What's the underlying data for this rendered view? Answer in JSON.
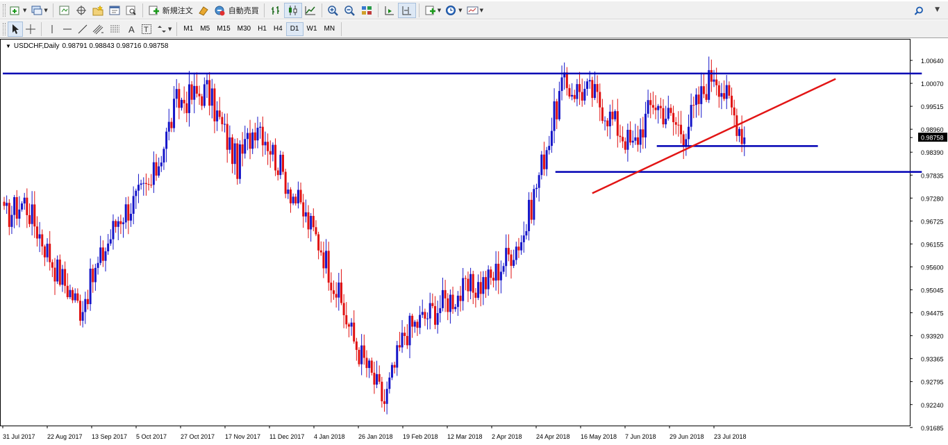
{
  "toolbar_top": {
    "new_order_label": "新規注文",
    "auto_trade_label": "自動売買"
  },
  "toolbar_bottom": {
    "timeframes": [
      "M1",
      "M5",
      "M15",
      "M30",
      "H1",
      "H4",
      "D1",
      "W1",
      "MN"
    ],
    "active_timeframe": "D1"
  },
  "chart": {
    "symbol_label": "USDCHF,Daily",
    "ohlc": "0.98791 0.98843 0.98716 0.98758",
    "current_price": "0.98758"
  },
  "colors": {
    "bull": "#1515c8",
    "bear": "#e01010",
    "hline": "#0000b4",
    "trendline": "#e21515",
    "price_tag_bg": "#000000"
  },
  "chart_data": {
    "type": "candlestick",
    "symbol": "USDCHF",
    "timeframe": "Daily",
    "y_ticks": [
      "1.00640",
      "1.00070",
      "0.99515",
      "0.98960",
      "0.98390",
      "0.97835",
      "0.97280",
      "0.96725",
      "0.96155",
      "0.95600",
      "0.95045",
      "0.94475",
      "0.93920",
      "0.93365",
      "0.92795",
      "0.92240",
      "0.91685"
    ],
    "x_ticks": [
      "31 Jul 2017",
      "22 Aug 2017",
      "13 Sep 2017",
      "5 Oct 2017",
      "27 Oct 2017",
      "17 Nov 2017",
      "11 Dec 2017",
      "4 Jan 2018",
      "26 Jan 2018",
      "19 Feb 2018",
      "12 Mar 2018",
      "2 Apr 2018",
      "24 Apr 2018",
      "16 May 2018",
      "7 Jun 2018",
      "29 Jun 2018",
      "23 Jul 2018"
    ],
    "ylim": [
      0.9162,
      1.008
    ],
    "path_keypoints": [
      {
        "i": 0,
        "p": 0.968
      },
      {
        "i": 8,
        "p": 0.972
      },
      {
        "i": 20,
        "p": 0.956
      },
      {
        "i": 30,
        "p": 0.946
      },
      {
        "i": 45,
        "p": 0.968
      },
      {
        "i": 58,
        "p": 0.976
      },
      {
        "i": 68,
        "p": 0.996
      },
      {
        "i": 80,
        "p": 0.999
      },
      {
        "i": 92,
        "p": 0.981
      },
      {
        "i": 100,
        "p": 0.992
      },
      {
        "i": 112,
        "p": 0.976
      },
      {
        "i": 125,
        "p": 0.961
      },
      {
        "i": 138,
        "p": 0.938
      },
      {
        "i": 150,
        "p": 0.923
      },
      {
        "i": 158,
        "p": 0.94
      },
      {
        "i": 175,
        "p": 0.948
      },
      {
        "i": 192,
        "p": 0.953
      },
      {
        "i": 205,
        "p": 0.964
      },
      {
        "i": 220,
        "p": 1.0
      },
      {
        "i": 232,
        "p": 0.9985
      },
      {
        "i": 248,
        "p": 0.985
      },
      {
        "i": 256,
        "p": 0.9965
      },
      {
        "i": 268,
        "p": 0.989
      },
      {
        "i": 280,
        "p": 1.004
      },
      {
        "i": 292,
        "p": 0.9876
      }
    ],
    "horizontal_lines": [
      {
        "price": 1.0032,
        "from_i": 0,
        "to_i": 362
      },
      {
        "price": 0.9855,
        "from_i": 258,
        "to_i": 321
      },
      {
        "price": 0.9792,
        "from_i": 218,
        "to_i": 362
      }
    ],
    "trendline": {
      "from": {
        "i": 232,
        "p": 0.974
      },
      "to": {
        "i": 328,
        "p": 1.0019
      }
    }
  }
}
